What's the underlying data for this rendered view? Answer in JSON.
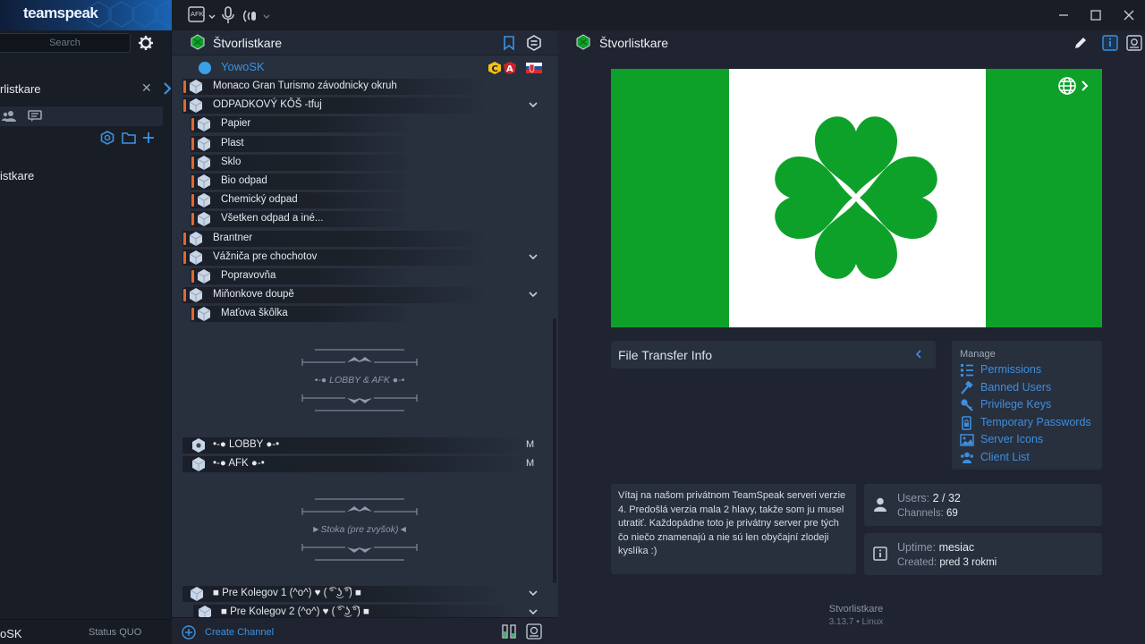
{
  "app": {
    "brand": "teamspeak"
  },
  "sidebar": {
    "search_placeholder": "Search",
    "server_tab_label": "rlistkare",
    "close_symbol": "✕",
    "bookmark_label": "istkare",
    "footer_nick": "oSK",
    "footer_status": "Status QUO"
  },
  "toolbar": {
    "afk_label": "AFK"
  },
  "tree": {
    "server_name": "Štvorlistkare",
    "user": {
      "name": "YowoSK",
      "color": "#3d92e0"
    },
    "channels": [
      {
        "label": "Monaco Gran Turismo závodnicky okruh",
        "indent": 0,
        "expand": false
      },
      {
        "label": "ODPADKOVÝ KÔŠ -tfuj",
        "indent": 0,
        "expand": true
      },
      {
        "label": "Papier",
        "indent": 1,
        "expand": false
      },
      {
        "label": "Plast",
        "indent": 1,
        "expand": false
      },
      {
        "label": "Sklo",
        "indent": 1,
        "expand": false
      },
      {
        "label": "Bio odpad",
        "indent": 1,
        "expand": false
      },
      {
        "label": "Chemický odpad",
        "indent": 1,
        "expand": false
      },
      {
        "label": "Všetken odpad a iné...",
        "indent": 1,
        "expand": false
      },
      {
        "label": "Brantner",
        "indent": 0,
        "expand": false
      },
      {
        "label": "Vážniča pre chochotov",
        "indent": 0,
        "expand": true
      },
      {
        "label": "Popravovňa",
        "indent": 1,
        "expand": false
      },
      {
        "label": "Miňonkove doupě",
        "indent": 0,
        "expand": true
      },
      {
        "label": "Maťova škôlka",
        "indent": 1,
        "expand": false
      }
    ],
    "spacer_lobby": "•-● LOBBY & AFK ●-•",
    "lobby": {
      "label": "•-● LOBBY ●-•",
      "flag": "M"
    },
    "afk": {
      "label": "•-● AFK ●-•",
      "flag": "M"
    },
    "spacer_stoka": "►Stoka (pre zvyšok)◄",
    "colleagues_1": "■ Pre Kolegov 1 (^o^) ♥ ( ͡° ͜ʖ ͡°) ■",
    "colleagues_2": "■ Pre Kolegov 2 (^o^) ♥ ( ͡° ͜ʖ ͡°) ■",
    "create_channel": "Create Channel"
  },
  "info": {
    "server_name": "Štvorlistkare",
    "banner_colors": {
      "green": "#0ea12a",
      "white": "#ffffff"
    },
    "file_transfer_label": "File Transfer Info",
    "manage": {
      "heading": "Manage",
      "items": [
        {
          "label": "Permissions",
          "icon": "permissions-icon"
        },
        {
          "label": "Banned Users",
          "icon": "hammer-icon"
        },
        {
          "label": "Privilege Keys",
          "icon": "key-icon"
        },
        {
          "label": "Temporary Passwords",
          "icon": "password-icon"
        },
        {
          "label": "Server Icons",
          "icon": "image-icon"
        },
        {
          "label": "Client List",
          "icon": "users-icon"
        }
      ]
    },
    "welcome": "Vítaj na našom privátnom TeamSpeak serveri verzie 4. Predošlá verzia mala 2 hlavy, takže som ju musel utratiť. Každopádne toto je privátny server pre tých čo niečo znamenajú a nie sú len obyčajní zlodeji kyslíka :)",
    "stats": {
      "users_key": "Users:",
      "users_val": "2 / 32",
      "channels_key": "Channels:",
      "channels_val": "69",
      "uptime_key": "Uptime:",
      "uptime_val": "mesiac",
      "created_key": "Created:",
      "created_val": "pred 3 rokmi"
    },
    "footer_name": "Stvorlistkare",
    "footer_version": "3.13.7 • Linux"
  },
  "colors": {
    "accent": "#3d92e0",
    "orange": "#e0692f",
    "panel": "#282f3d"
  }
}
